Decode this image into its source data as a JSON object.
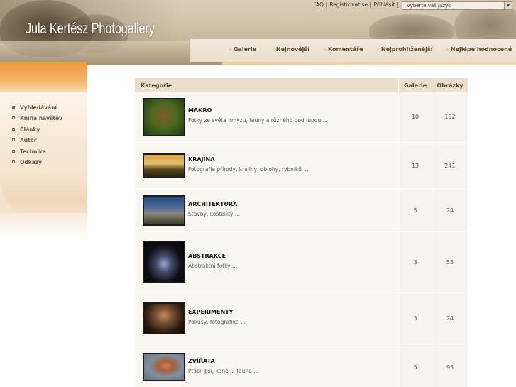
{
  "header": {
    "site_title": "Jula Kertész Photogallery",
    "top_links": [
      "FAQ",
      "Registrovat se",
      "Přihlásit"
    ],
    "language_select": {
      "value": "Vyberte Váš jazyk"
    }
  },
  "nav": {
    "items": [
      "Galerie",
      "Nejnovější",
      "Komentáře",
      "Nejprohlíženější",
      "Nejlépe hodnocené"
    ]
  },
  "sidebar": {
    "items": [
      "Vyhledávání",
      "Kniha návštěv",
      "Články",
      "Autor",
      "Technika",
      "Odkazy"
    ]
  },
  "table": {
    "headers": {
      "category": "Kategorie",
      "galleries": "Galerie",
      "images": "Obrázky"
    },
    "rows": [
      {
        "name": "MAKRO",
        "description": "Fotky ze světa hmyzu, fauny a různého pod lupou ...",
        "galleries": "10",
        "images": "182",
        "thumb": "macro-insect-photo"
      },
      {
        "name": "KRAJINA",
        "description": "Fotografie přírody, krajiny, oblohy, rybníků ...",
        "galleries": "13",
        "images": "241",
        "thumb": "landscape-pond-photo"
      },
      {
        "name": "ARCHITEKTURA",
        "description": "Stavby, kostelíky ...",
        "galleries": "5",
        "images": "24",
        "thumb": "architecture-church-photo"
      },
      {
        "name": "ABSTRAKCE",
        "description": "Abstraktní fotky ...",
        "galleries": "3",
        "images": "55",
        "thumb": "abstract-light-photo"
      },
      {
        "name": "EXPERIMENTY",
        "description": "Pokusy, fotografika ...",
        "galleries": "3",
        "images": "24",
        "thumb": "experiment-portrait-photo"
      },
      {
        "name": "ZVÍŘATA",
        "description": "Ptáci, psi, koně ... fauna ...",
        "galleries": "5",
        "images": "95",
        "thumb": "animal-bird-photo"
      }
    ]
  },
  "colors": {
    "accent_orange": "#f19a3c",
    "header_tan": "#cdbfa5",
    "nav_text": "#5a4a34",
    "table_header": "#eadfcd"
  }
}
